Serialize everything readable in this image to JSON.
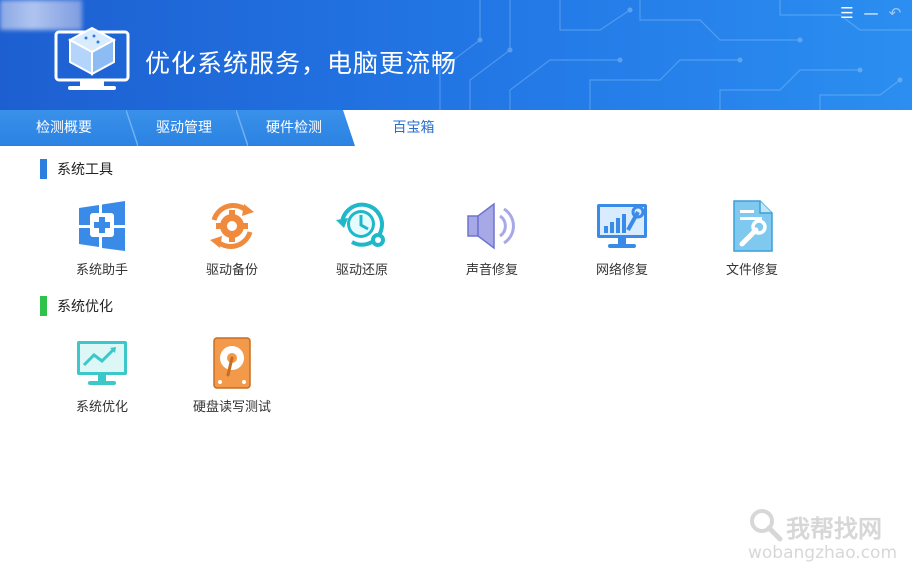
{
  "header": {
    "title": "优化系统服务，电脑更流畅",
    "logo_icon": "computer-box-logo-icon",
    "controls": [
      {
        "name": "menu-icon",
        "glyph": "☰"
      },
      {
        "name": "minimize-icon",
        "glyph": "—"
      },
      {
        "name": "back-icon",
        "glyph": "↶"
      }
    ]
  },
  "tabs": [
    {
      "label": "检测概要",
      "active": false
    },
    {
      "label": "驱动管理",
      "active": false
    },
    {
      "label": "硬件检测",
      "active": false
    },
    {
      "label": "百宝箱",
      "active": true
    }
  ],
  "sections": [
    {
      "title": "系统工具",
      "bar_color": "#2b7fe0",
      "tools": [
        {
          "label": "系统助手",
          "icon": "windows-plus-icon"
        },
        {
          "label": "驱动备份",
          "icon": "gear-cycle-icon"
        },
        {
          "label": "驱动还原",
          "icon": "clock-restore-icon"
        },
        {
          "label": "声音修复",
          "icon": "speaker-icon"
        },
        {
          "label": "网络修复",
          "icon": "network-wrench-icon"
        },
        {
          "label": "文件修复",
          "icon": "file-wrench-icon"
        }
      ]
    },
    {
      "title": "系统优化",
      "bar_color": "#2fc24a",
      "tools": [
        {
          "label": "系统优化",
          "icon": "monitor-trend-icon"
        },
        {
          "label": "硬盘读写测试",
          "icon": "hard-disk-icon"
        }
      ]
    }
  ],
  "watermark": {
    "cn": "我帮找网",
    "en": "wobangzhao.com"
  },
  "colors": {
    "header_start": "#1d5fd1",
    "header_end": "#2b8ef0",
    "tab_active_text": "#2a6fcc"
  }
}
